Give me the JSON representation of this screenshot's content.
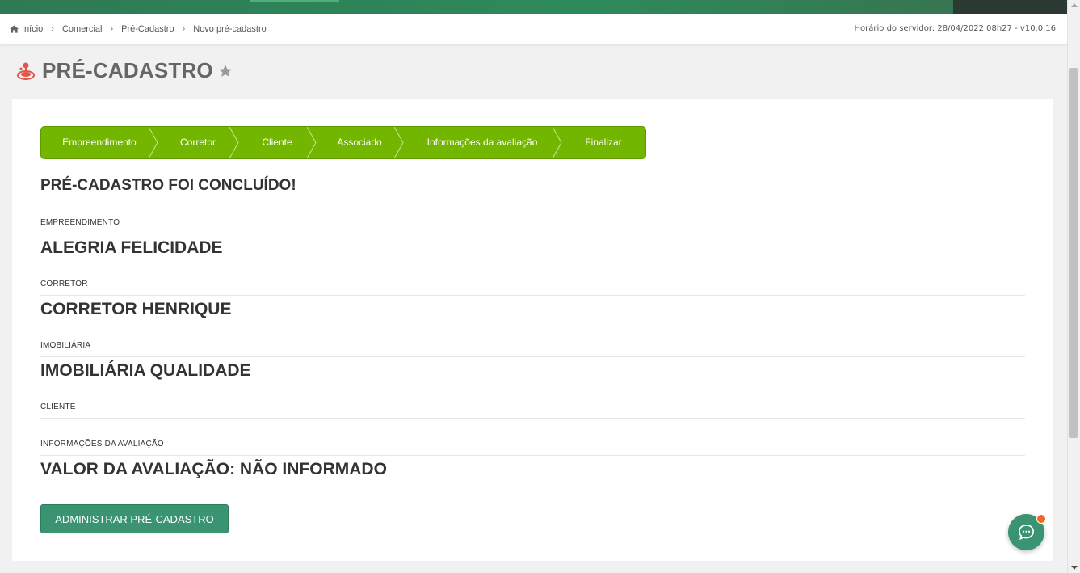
{
  "breadcrumb": {
    "items": [
      "Início",
      "Comercial",
      "Pré-Cadastro",
      "Novo pré-cadastro"
    ],
    "server_time": "Horário do servidor: 28/04/2022 08h27 - v10.0.16"
  },
  "page": {
    "title": "PRÉ-CADASTRO"
  },
  "wizard": {
    "steps": [
      "Empreendimento",
      "Corretor",
      "Cliente",
      "Associado",
      "Informações da avaliação",
      "Finalizar"
    ],
    "color": "#73b600"
  },
  "summary": {
    "heading": "PRÉ-CADASTRO FOI CONCLUÍDO!",
    "empreendimento_label": "EMPREENDIMENTO",
    "empreendimento_value": "ALEGRIA FELICIDADE",
    "corretor_label": "CORRETOR",
    "corretor_value": "CORRETOR HENRIQUE",
    "imobiliaria_label": "IMOBILIÁRIA",
    "imobiliaria_value": "IMOBILIÁRIA QUALIDADE",
    "cliente_label": "CLIENTE",
    "avaliacao_label": "INFORMAÇÕES DA AVALIAÇÃO",
    "avaliacao_value": "VALOR DA AVALIAÇÃO: NÃO INFORMADO"
  },
  "actions": {
    "admin_label": "ADMINISTRAR PRÉ-CADASTRO"
  },
  "colors": {
    "brand_green": "#3a9472",
    "notification": "#f26522"
  },
  "icons": [
    "home-icon",
    "chevron-right-icon",
    "joystick-icon",
    "star-icon",
    "chat-icon"
  ]
}
